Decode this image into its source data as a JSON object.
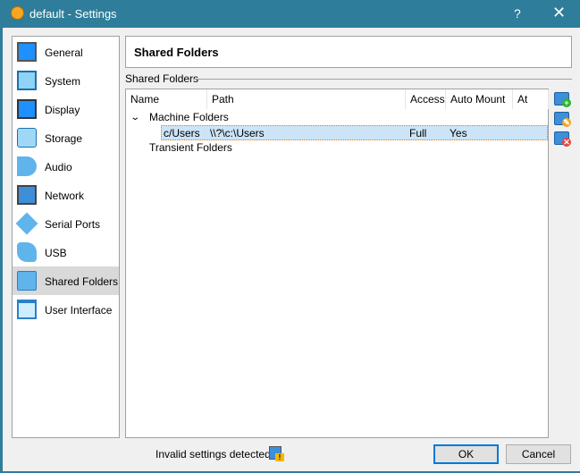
{
  "window": {
    "title": "default - Settings",
    "help": "?",
    "close": "✕"
  },
  "sidebar": {
    "items": [
      {
        "label": "General",
        "icon": "monitor-icon"
      },
      {
        "label": "System",
        "icon": "chip-icon"
      },
      {
        "label": "Display",
        "icon": "display-icon"
      },
      {
        "label": "Storage",
        "icon": "storage-icon"
      },
      {
        "label": "Audio",
        "icon": "speaker-icon"
      },
      {
        "label": "Network",
        "icon": "network-icon"
      },
      {
        "label": "Serial Ports",
        "icon": "serial-port-icon"
      },
      {
        "label": "USB",
        "icon": "usb-icon"
      },
      {
        "label": "Shared Folders",
        "icon": "folder-icon",
        "selected": true
      },
      {
        "label": "User Interface",
        "icon": "user-interface-icon"
      }
    ]
  },
  "header": {
    "title": "Shared Folders"
  },
  "group": {
    "label": "Shared Folders"
  },
  "table": {
    "columns": [
      "Name",
      "Path",
      "Access",
      "Auto Mount",
      "At"
    ],
    "groups": [
      {
        "label": "Machine Folders",
        "expanded": true,
        "rows": [
          {
            "name": "c/Users",
            "path": "\\\\?\\c:\\Users",
            "access": "Full",
            "auto_mount": "Yes",
            "at": ""
          }
        ]
      },
      {
        "label": "Transient Folders",
        "rows": []
      }
    ]
  },
  "tools": {
    "add": "+",
    "edit": "✎",
    "remove": "✕"
  },
  "footer": {
    "status": "Invalid settings detected",
    "ok": "OK",
    "cancel": "Cancel"
  },
  "colors": {
    "titlebar": "#2e7d9a",
    "selection": "#cce4f7",
    "accent": "#0078d7"
  }
}
